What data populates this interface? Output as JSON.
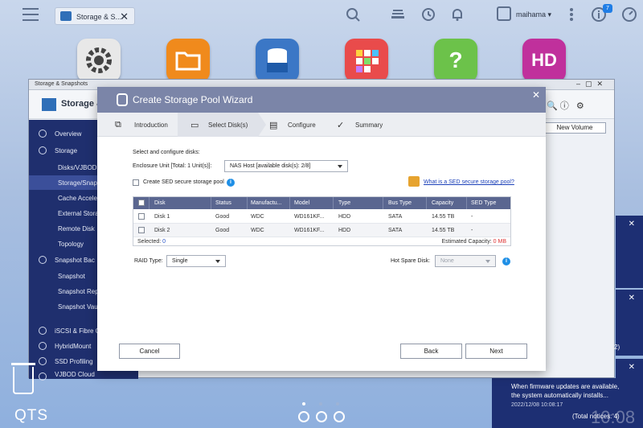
{
  "topbar": {
    "task_tab_label": "Storage & S...",
    "task_tab_close": "✕",
    "username": "maihama ▾",
    "notification_count": "7"
  },
  "desktop_apps": [
    {
      "name": "settings",
      "color": "#e8e8e8"
    },
    {
      "name": "file-station",
      "color": "#f08a1c"
    },
    {
      "name": "storage-snapshots",
      "color": "#3b77c6"
    },
    {
      "name": "app-center",
      "color": "#e94b4b"
    },
    {
      "name": "help-center",
      "color": "#6cc24a"
    },
    {
      "name": "hd-station",
      "color": "#c0309c"
    }
  ],
  "bg_window": {
    "header_title": "Storage & Snapshots",
    "toolbar_title": "Storage & S",
    "new_volume_label": "New Volume",
    "sidebar": [
      {
        "label": "Overview",
        "indent": false,
        "selected": false
      },
      {
        "label": "Storage",
        "indent": false,
        "selected": false
      },
      {
        "label": "Disks/VJBOD",
        "indent": true,
        "selected": false
      },
      {
        "label": "Storage/Snapsh",
        "indent": true,
        "selected": true
      },
      {
        "label": "Cache Acceler",
        "indent": true,
        "selected": false
      },
      {
        "label": "External Stora",
        "indent": true,
        "selected": false
      },
      {
        "label": "Remote Disk",
        "indent": true,
        "selected": false
      },
      {
        "label": "Topology",
        "indent": true,
        "selected": false
      },
      {
        "label": "Snapshot Bac",
        "indent": false,
        "selected": false
      },
      {
        "label": "Snapshot",
        "indent": true,
        "selected": false
      },
      {
        "label": "Snapshot Rep",
        "indent": true,
        "selected": false
      },
      {
        "label": "Snapshot Vau",
        "indent": true,
        "selected": false
      },
      {
        "label": "iSCSI & Fibre C",
        "indent": false,
        "selected": false
      },
      {
        "label": "HybridMount",
        "indent": false,
        "selected": false
      },
      {
        "label": "SSD Profiling",
        "indent": false,
        "selected": false
      },
      {
        "label": "VJBOD Cloud",
        "indent": false,
        "selected": false
      }
    ]
  },
  "notifications": {
    "badge_two": "2)",
    "message_line1": "When firmware updates are available,",
    "message_line2": "the system automatically installs...",
    "timestamp": "2022/12/08 10:08:17",
    "total": "(Total notices: 4)",
    "clock": "10:08"
  },
  "dock": {
    "brand": "QTS"
  },
  "wizard": {
    "title": "Create Storage Pool Wizard",
    "steps": [
      {
        "label": "Introduction",
        "active": false
      },
      {
        "label": "Select Disk(s)",
        "active": true
      },
      {
        "label": "Configure",
        "active": false
      },
      {
        "label": "Summary",
        "active": false
      }
    ],
    "section_label": "Select and configure disks:",
    "enclosure_label": "Enclosure Unit [Total: 1 Unit(s)]:",
    "enclosure_value": "NAS Host [available disk(s): 2/8]",
    "sed_checkbox_label": "Create SED secure storage pool",
    "sed_link": "What is a SED secure storage pool?",
    "table": {
      "columns": [
        "Disk",
        "Status",
        "Manufactu...",
        "Model",
        "Type",
        "Bus Type",
        "Capacity",
        "SED Type"
      ],
      "rows": [
        [
          "Disk 1",
          "Good",
          "WDC",
          "WD161KF...",
          "HDD",
          "SATA",
          "14.55 TB",
          "-"
        ],
        [
          "Disk 2",
          "Good",
          "WDC",
          "WD161KF...",
          "HDD",
          "SATA",
          "14.55 TB",
          "-"
        ]
      ],
      "selected_label": "Selected:",
      "selected_count": "0",
      "capacity_label": "Estimated Capacity:",
      "capacity_value": "0 MB"
    },
    "raid_label": "RAID Type:",
    "raid_value": "Single",
    "hotspare_label": "Hot Spare Disk:",
    "hotspare_value": "None",
    "buttons": {
      "cancel": "Cancel",
      "back": "Back",
      "next": "Next"
    }
  }
}
